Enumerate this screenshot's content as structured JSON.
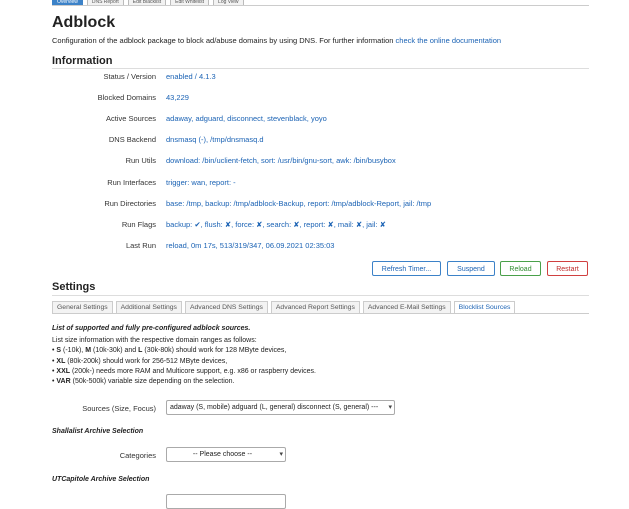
{
  "top_tabs": [
    {
      "label": "Overview",
      "active": true
    },
    {
      "label": "DNS Report"
    },
    {
      "label": "Edit Blacklist"
    },
    {
      "label": "Edit Whitelist"
    },
    {
      "label": "Log View"
    }
  ],
  "page": {
    "title": "Adblock",
    "description": "Configuration of the adblock package to block ad/abuse domains by using DNS. For further information",
    "doc_link": "check the online documentation"
  },
  "information": {
    "heading": "Information",
    "rows": [
      {
        "label": "Status / Version",
        "value": "enabled / 4.1.3"
      },
      {
        "label": "Blocked Domains",
        "value": "43,229"
      },
      {
        "label": "Active Sources",
        "value": "adaway, adguard, disconnect, stevenblack, yoyo"
      },
      {
        "label": "DNS Backend",
        "value": "dnsmasq (-), /tmp/dnsmasq.d"
      },
      {
        "label": "Run Utils",
        "value": "download: /bin/uclient-fetch, sort: /usr/bin/gnu-sort, awk: /bin/busybox"
      },
      {
        "label": "Run Interfaces",
        "value": "trigger: wan, report: -"
      },
      {
        "label": "Run Directories",
        "value": "base: /tmp, backup: /tmp/adblock-Backup, report: /tmp/adblock-Report, jail: /tmp"
      },
      {
        "label": "Run Flags",
        "value": "backup: ✔, flush: ✘, force: ✘, search: ✘, report: ✘, mail: ✘, jail: ✘"
      },
      {
        "label": "Last Run",
        "value": "reload, 0m 17s, 513/319/347, 06.09.2021 02:35:03"
      }
    ]
  },
  "actions": {
    "refresh_timer": "Refresh Timer...",
    "suspend": "Suspend",
    "reload": "Reload",
    "restart": "Restart"
  },
  "settings": {
    "heading": "Settings",
    "tabs": [
      {
        "label": "General Settings"
      },
      {
        "label": "Additional Settings"
      },
      {
        "label": "Advanced DNS Settings"
      },
      {
        "label": "Advanced Report Settings"
      },
      {
        "label": "Advanced E-Mail Settings"
      },
      {
        "label": "Blocklist Sources",
        "active": true
      }
    ]
  },
  "blocklist": {
    "title": "List of supported and fully pre-configured adblock sources.",
    "intro": "List size information with the respective domain ranges as follows:",
    "items": [
      {
        "b1": "S",
        "t1": " (-10k), ",
        "b2": "M",
        "t2": " (10k-30k) and ",
        "b3": "L",
        "t3": " (30k-80k) should work for 128 MByte devices,"
      },
      {
        "b1": "XL",
        "t1": " (80k-200k) should work for 256-512 MByte devices,",
        "b2": "",
        "t2": "",
        "b3": "",
        "t3": ""
      },
      {
        "b1": "XXL",
        "t1": " (200k-) needs more RAM and Multicore support, e.g. x86 or raspberry devices.",
        "b2": "",
        "t2": "",
        "b3": "",
        "t3": ""
      },
      {
        "b1": "VAR",
        "t1": " (50k-500k) variable size depending on the selection.",
        "b2": "",
        "t2": "",
        "b3": "",
        "t3": ""
      }
    ],
    "sources_label": "Sources (Size, Focus)",
    "sources_value": "adaway (S, mobile) adguard (L, general) disconnect (S, general) ---",
    "shallalist_heading": "Shallalist Archive Selection",
    "categories_label": "Categories",
    "categories_value": "-- Please choose --",
    "utcapitole_heading": "UTCapitole Archive Selection"
  }
}
